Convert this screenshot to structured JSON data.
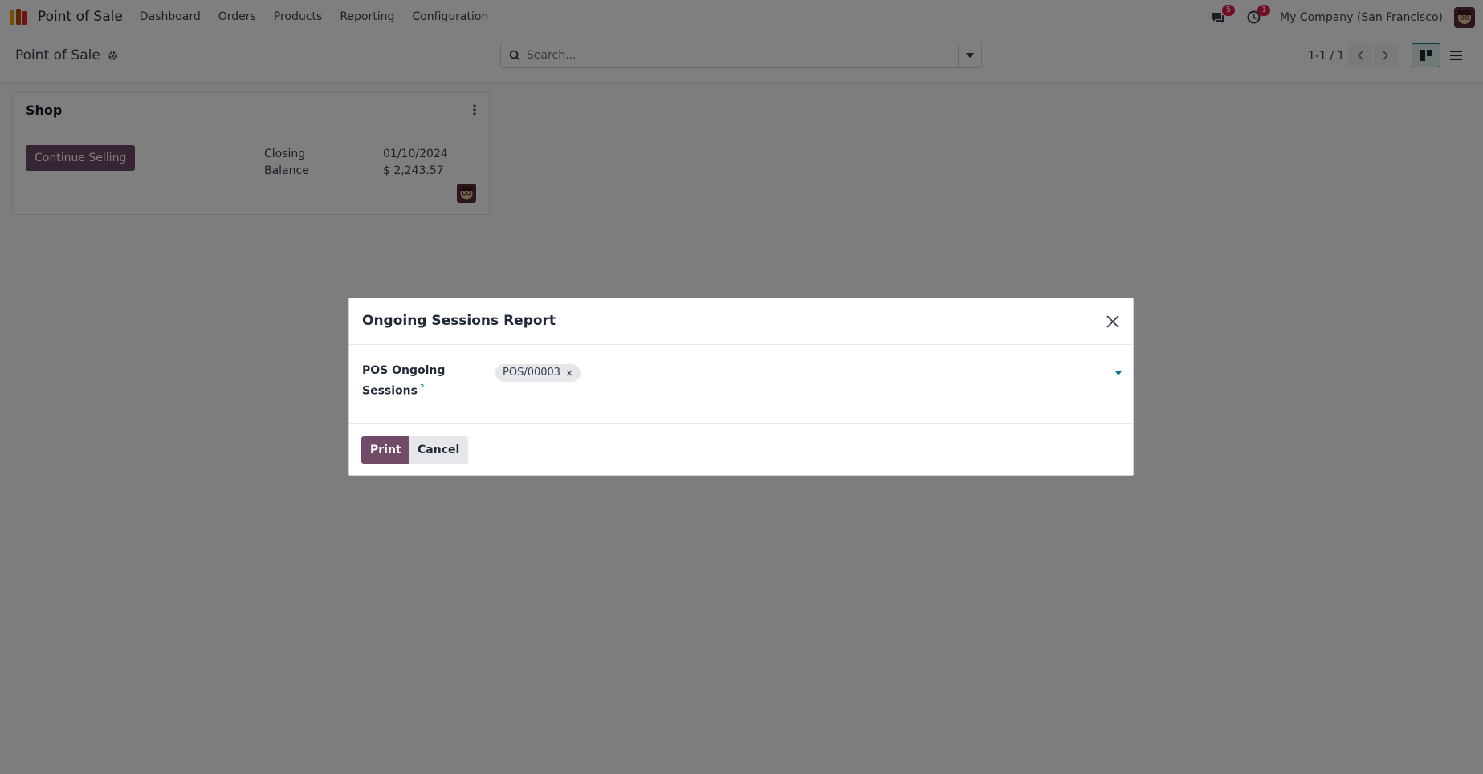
{
  "navbar": {
    "app_name": "Point of Sale",
    "menu": [
      "Dashboard",
      "Orders",
      "Products",
      "Reporting",
      "Configuration"
    ],
    "messages_badge": "5",
    "activities_badge": "1",
    "company": "My Company (San Francisco)"
  },
  "control_panel": {
    "breadcrumb_title": "Point of Sale",
    "search_placeholder": "Search...",
    "pager": "1-1 / 1"
  },
  "kanban": {
    "card": {
      "title": "Shop",
      "button_label": "Continue Selling",
      "labels": [
        "Closing",
        "Balance"
      ],
      "values": [
        "01/10/2024",
        "$ 2,243.57"
      ]
    }
  },
  "modal": {
    "title": "Ongoing Sessions Report",
    "field_label": "POS Ongoing Sessions",
    "help_mark": "?",
    "tags": [
      "POS/00003"
    ],
    "print_label": "Print",
    "cancel_label": "Cancel"
  },
  "colors": {
    "brand": "#714b67",
    "accent": "#017e84",
    "badge": "#e11d48"
  },
  "icons": {
    "app_logo": "pos-logo-icon",
    "messages": "chat-icon",
    "activities": "clock-icon",
    "settings": "gear-icon",
    "search": "search-icon",
    "close": "close-icon"
  }
}
